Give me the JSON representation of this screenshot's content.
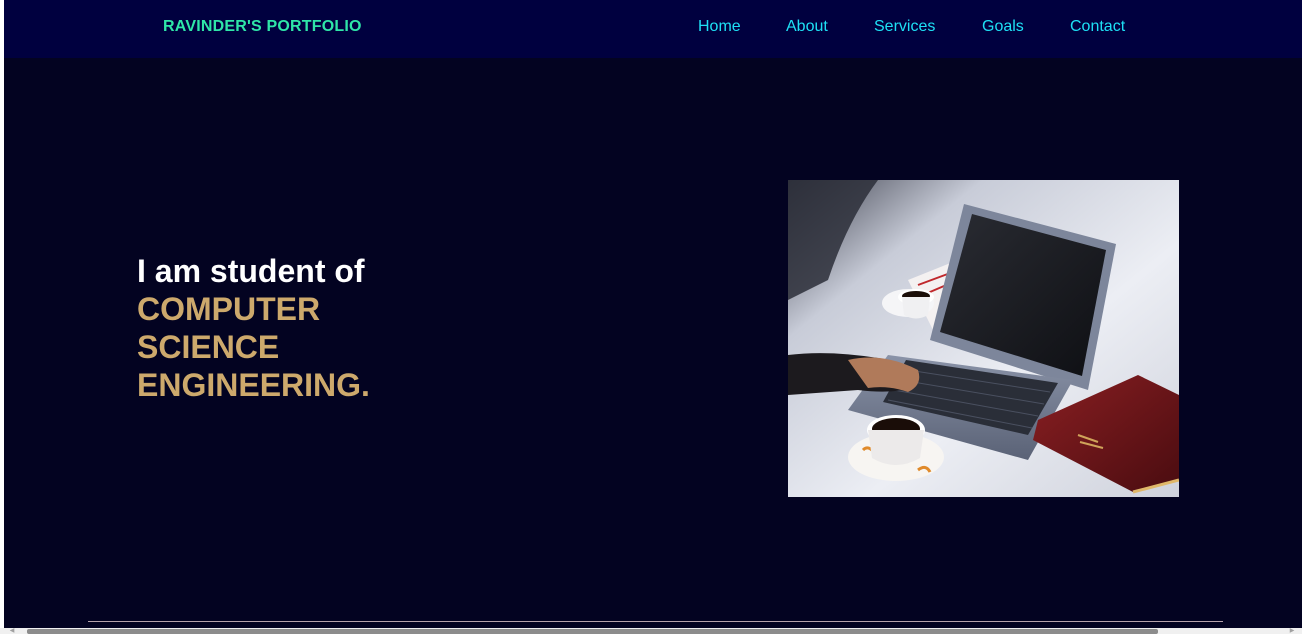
{
  "brand": {
    "name": "RAVINDER'S PORTFOLIO"
  },
  "nav": {
    "items": [
      {
        "label": "Home"
      },
      {
        "label": "About"
      },
      {
        "label": "Services"
      },
      {
        "label": "Goals"
      },
      {
        "label": "Contact"
      }
    ]
  },
  "hero": {
    "lead": "I am student of",
    "field_line1": "COMPUTER",
    "field_line2": "SCIENCE",
    "field_line3": "ENGINEERING.",
    "image_icon": "laptop-coffee-photo"
  },
  "colors": {
    "background": "#030321",
    "navbar": "#00003f",
    "brand": "#2fe6a8",
    "nav_link": "#1ee0f5",
    "accent": "#cda96c"
  }
}
